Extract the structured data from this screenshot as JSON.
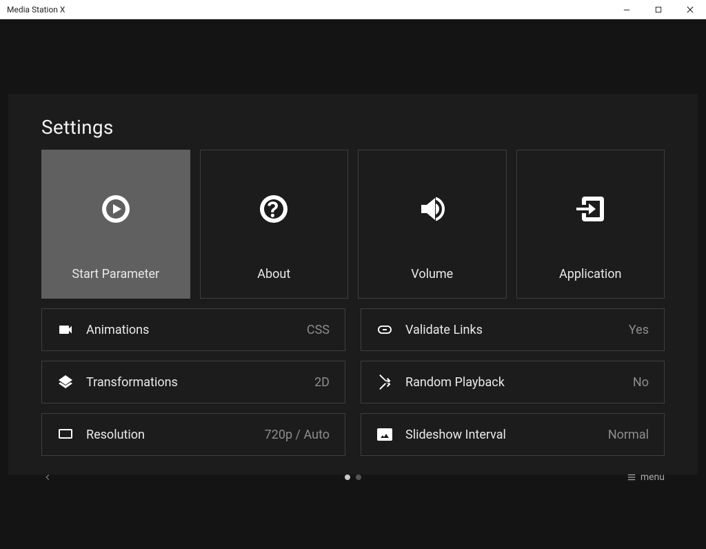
{
  "window": {
    "title": "Media Station X"
  },
  "page": {
    "title": "Settings"
  },
  "tiles": [
    {
      "label": "Start Parameter",
      "selected": true,
      "icon": "play-circle-icon"
    },
    {
      "label": "About",
      "selected": false,
      "icon": "help-circle-icon"
    },
    {
      "label": "Volume",
      "selected": false,
      "icon": "speaker-icon"
    },
    {
      "label": "Application",
      "selected": false,
      "icon": "exit-icon"
    }
  ],
  "options_left": [
    {
      "label": "Animations",
      "value": "CSS",
      "icon": "videocam-icon"
    },
    {
      "label": "Transformations",
      "value": "2D",
      "icon": "layers-icon"
    },
    {
      "label": "Resolution",
      "value": "720p / Auto",
      "icon": "monitor-icon"
    }
  ],
  "options_right": [
    {
      "label": "Validate Links",
      "value": "Yes",
      "icon": "link-icon"
    },
    {
      "label": "Random Playback",
      "value": "No",
      "icon": "shuffle-icon"
    },
    {
      "label": "Slideshow Interval",
      "value": "Normal",
      "icon": "image-icon"
    }
  ],
  "footer": {
    "menu_label": "menu",
    "pages": 2,
    "active_page": 0
  }
}
